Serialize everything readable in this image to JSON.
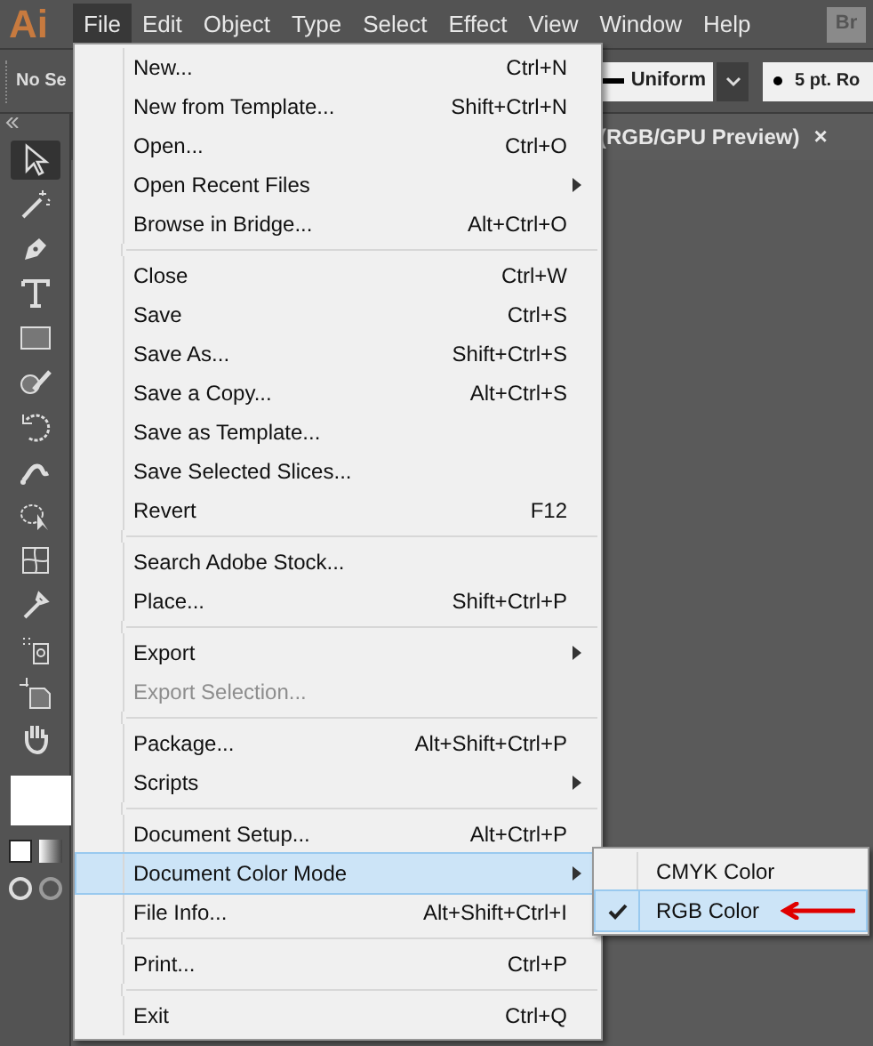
{
  "app_logo": "Ai",
  "menubar": [
    {
      "label": "File",
      "selected": true
    },
    {
      "label": "Edit",
      "selected": false
    },
    {
      "label": "Object",
      "selected": false
    },
    {
      "label": "Type",
      "selected": false
    },
    {
      "label": "Select",
      "selected": false
    },
    {
      "label": "Effect",
      "selected": false
    },
    {
      "label": "View",
      "selected": false
    },
    {
      "label": "Window",
      "selected": false
    },
    {
      "label": "Help",
      "selected": false
    }
  ],
  "bridge_button": "Br",
  "control_bar": {
    "selection": "No Se",
    "stroke_profile": "Uniform",
    "brush": "5 pt. Ro"
  },
  "document_tab": {
    "title": "(RGB/GPU Preview)",
    "close": "×"
  },
  "file_menu": [
    {
      "kind": "item",
      "label": "New...",
      "shortcut": "Ctrl+N",
      "submenu": false,
      "disabled": false,
      "selected": false
    },
    {
      "kind": "item",
      "label": "New from Template...",
      "shortcut": "Shift+Ctrl+N",
      "submenu": false,
      "disabled": false,
      "selected": false
    },
    {
      "kind": "item",
      "label": "Open...",
      "shortcut": "Ctrl+O",
      "submenu": false,
      "disabled": false,
      "selected": false
    },
    {
      "kind": "item",
      "label": "Open Recent Files",
      "submenu": true,
      "disabled": false,
      "selected": false
    },
    {
      "kind": "item",
      "label": "Browse in Bridge...",
      "shortcut": "Alt+Ctrl+O",
      "submenu": false,
      "disabled": false,
      "selected": false
    },
    {
      "kind": "separator"
    },
    {
      "kind": "item",
      "label": "Close",
      "shortcut": "Ctrl+W",
      "submenu": false,
      "disabled": false,
      "selected": false
    },
    {
      "kind": "item",
      "label": "Save",
      "shortcut": "Ctrl+S",
      "submenu": false,
      "disabled": false,
      "selected": false
    },
    {
      "kind": "item",
      "label": "Save As...",
      "shortcut": "Shift+Ctrl+S",
      "submenu": false,
      "disabled": false,
      "selected": false
    },
    {
      "kind": "item",
      "label": "Save a Copy...",
      "shortcut": "Alt+Ctrl+S",
      "submenu": false,
      "disabled": false,
      "selected": false
    },
    {
      "kind": "item",
      "label": "Save as Template...",
      "submenu": false,
      "disabled": false,
      "selected": false
    },
    {
      "kind": "item",
      "label": "Save Selected Slices...",
      "submenu": false,
      "disabled": false,
      "selected": false
    },
    {
      "kind": "item",
      "label": "Revert",
      "shortcut": "F12",
      "submenu": false,
      "disabled": false,
      "selected": false
    },
    {
      "kind": "separator"
    },
    {
      "kind": "item",
      "label": "Search Adobe Stock...",
      "submenu": false,
      "disabled": false,
      "selected": false
    },
    {
      "kind": "item",
      "label": "Place...",
      "shortcut": "Shift+Ctrl+P",
      "submenu": false,
      "disabled": false,
      "selected": false
    },
    {
      "kind": "separator"
    },
    {
      "kind": "item",
      "label": "Export",
      "submenu": true,
      "disabled": false,
      "selected": false
    },
    {
      "kind": "item",
      "label": "Export Selection...",
      "submenu": false,
      "disabled": true,
      "selected": false
    },
    {
      "kind": "separator"
    },
    {
      "kind": "item",
      "label": "Package...",
      "shortcut": "Alt+Shift+Ctrl+P",
      "submenu": false,
      "disabled": false,
      "selected": false
    },
    {
      "kind": "item",
      "label": "Scripts",
      "submenu": true,
      "disabled": false,
      "selected": false
    },
    {
      "kind": "separator"
    },
    {
      "kind": "item",
      "label": "Document Setup...",
      "shortcut": "Alt+Ctrl+P",
      "submenu": false,
      "disabled": false,
      "selected": false
    },
    {
      "kind": "item",
      "label": "Document Color Mode",
      "submenu": true,
      "disabled": false,
      "selected": true
    },
    {
      "kind": "item",
      "label": "File Info...",
      "shortcut": "Alt+Shift+Ctrl+I",
      "submenu": false,
      "disabled": false,
      "selected": false
    },
    {
      "kind": "separator"
    },
    {
      "kind": "item",
      "label": "Print...",
      "shortcut": "Ctrl+P",
      "submenu": false,
      "disabled": false,
      "selected": false
    },
    {
      "kind": "separator"
    },
    {
      "kind": "item",
      "label": "Exit",
      "shortcut": "Ctrl+Q",
      "submenu": false,
      "disabled": false,
      "selected": false
    }
  ],
  "color_mode_submenu": [
    {
      "label": "CMYK Color",
      "checked": false,
      "selected": false
    },
    {
      "label": "RGB Color",
      "checked": true,
      "selected": true
    }
  ]
}
